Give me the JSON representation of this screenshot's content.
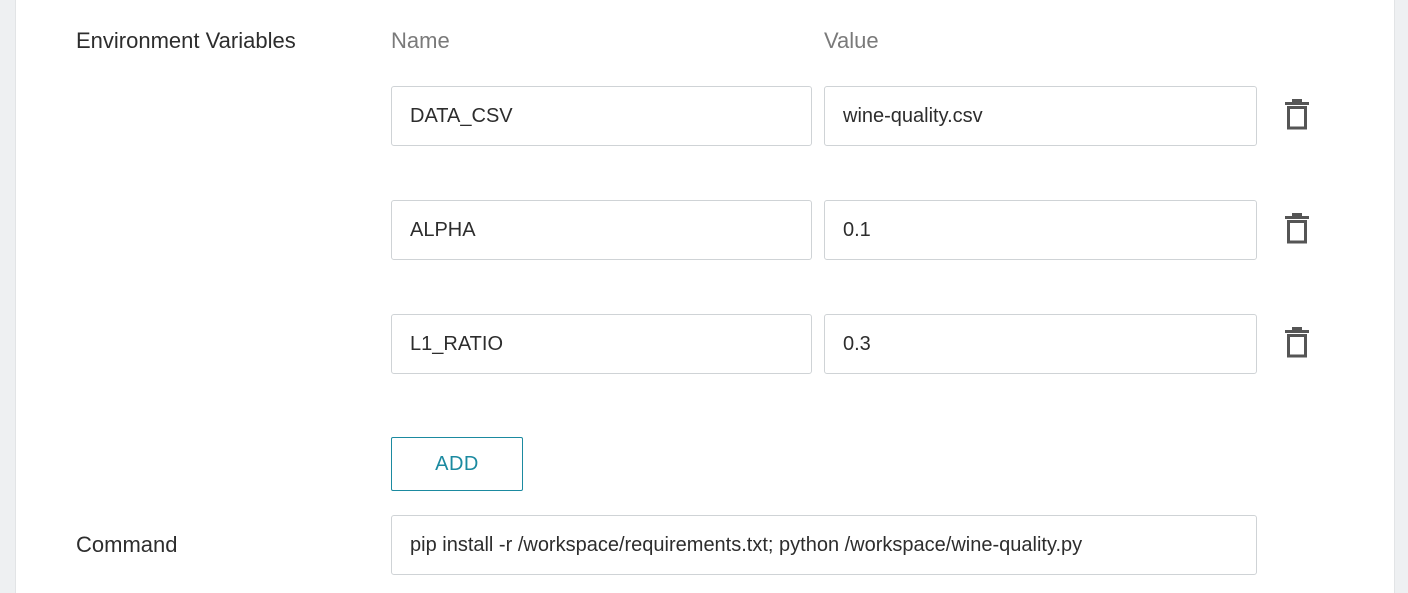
{
  "env": {
    "label": "Environment Variables",
    "name_header": "Name",
    "value_header": "Value",
    "rows": [
      {
        "name": "DATA_CSV",
        "value": "wine-quality.csv"
      },
      {
        "name": "ALPHA",
        "value": "0.1"
      },
      {
        "name": "L1_RATIO",
        "value": "0.3"
      }
    ],
    "delete_icon": "trash-icon",
    "add_label": "ADD"
  },
  "command": {
    "label": "Command",
    "value": "pip install -r /workspace/requirements.txt; python /workspace/wine-quality.py"
  },
  "colors": {
    "accent": "#1b8aa0",
    "text": "#2d2d2d",
    "muted": "#7a7a7a",
    "border": "#cfd3d6"
  }
}
